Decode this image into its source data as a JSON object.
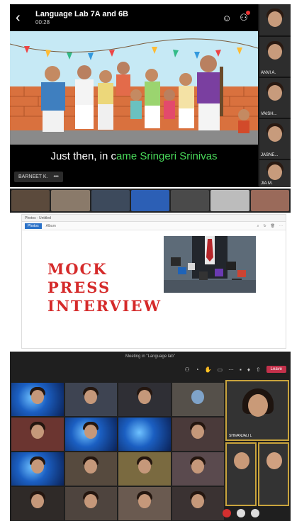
{
  "call": {
    "title": "Language Lab 7A and 6B",
    "time": "00:28",
    "subtitle_prefix": "Just then, in c",
    "subtitle_highlight": "ame Sringeri Srinivas",
    "speaker_name": "BARNEET K.",
    "more": "•••"
  },
  "side_participants": [
    {
      "name": ""
    },
    {
      "name": "ANVI A."
    },
    {
      "name": "VAISH..."
    },
    {
      "name": "JASNE..."
    },
    {
      "name": "JIA M."
    }
  ],
  "slide": {
    "tab": "Photos - Untitled",
    "toolbar_items": [
      "Photos",
      "Album"
    ],
    "heading_lines": [
      "MOCK",
      "PRESS",
      "INTERVIEW"
    ]
  },
  "gallery": {
    "title": "Meeting in \"Language lab\"",
    "leave_label": "Leave",
    "stage_tile_label": "SHIVANJALI L"
  },
  "colors": {
    "accent_red": "#d52a2a",
    "subtitle_green": "#49d95a",
    "teams_red": "#c4314b",
    "stage_gold": "#c9a43d"
  }
}
